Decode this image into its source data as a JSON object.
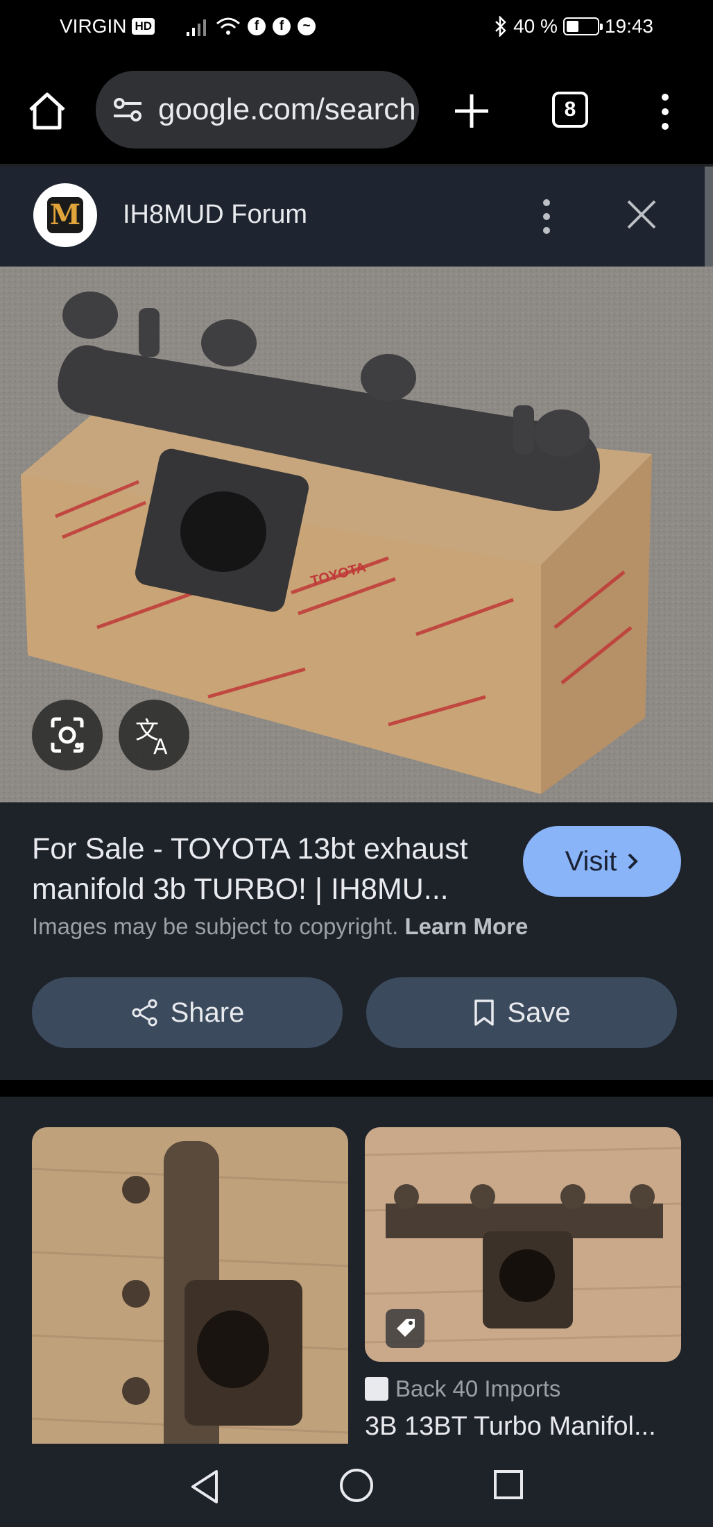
{
  "status_bar": {
    "carrier": "VIRGIN",
    "hd_badge": "HD",
    "battery_percent": "40 %",
    "battery_level": 0.4,
    "time": "19:43"
  },
  "browser": {
    "url": "google.com/search",
    "tab_count": "8"
  },
  "site_header": {
    "title": "IH8MUD Forum",
    "logo_letter": "M"
  },
  "result": {
    "title": "For Sale - TOYOTA 13bt exhaust manifold 3b TURBO! | IH8MU...",
    "visit_label": "Visit",
    "copyright_text": "Images may be subject to copyright.",
    "learn_more": "Learn More",
    "share_label": "Share",
    "save_label": "Save"
  },
  "related": {
    "source": "Back 40 Imports",
    "product_title": "3B 13BT Turbo Manifol..."
  },
  "hero_box_text": "TOYOTA",
  "colors": {
    "accent": "#8ab4f8",
    "pill_bg": "#3c4a5e",
    "panel_bg": "#1e2229"
  }
}
